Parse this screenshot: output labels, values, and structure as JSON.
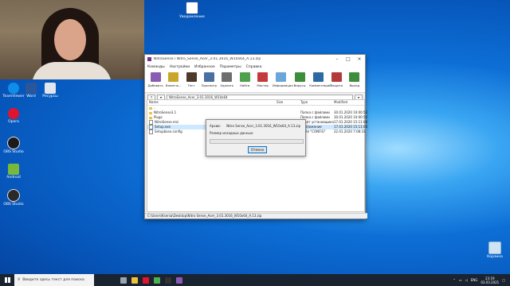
{
  "desktop": {
    "top_file_icon": "Уведомление",
    "icons_left": [
      {
        "label": "TeamViewer",
        "color": "#0e8ee9"
      },
      {
        "label": "Word",
        "color": "#2b579a"
      },
      {
        "label": "Ресурсы",
        "color": "#dfe6ee"
      },
      {
        "label": "Opera",
        "color": "#e0142e"
      },
      {
        "label": "OBS Studio",
        "color": "#1b1b1b"
      },
      {
        "label": "Android",
        "color": "#78b83a"
      },
      {
        "label": "OBS Studio",
        "color": "#2a2a2a"
      }
    ],
    "recycle_bin": "Корзина"
  },
  "window": {
    "title": "NitroSense / Nitro_Sense_Acer_3.01.3016_W10x64_A.13.zip",
    "menu": [
      "Команды",
      "Настройки",
      "Избранное",
      "Параметры",
      "Справка"
    ],
    "toolbar": [
      {
        "label": "Добавить",
        "color": "#8a5bb0"
      },
      {
        "label": "Извлечь...",
        "color": "#c9a52b"
      },
      {
        "label": "Тест",
        "color": "#4c3a2a"
      },
      {
        "label": "Просмотр",
        "color": "#4a6fa3"
      },
      {
        "label": "Удалить",
        "color": "#6e6e6e"
      },
      {
        "label": "Найти",
        "color": "#4ea04a"
      },
      {
        "label": "Мастер",
        "color": "#c43a3a"
      },
      {
        "label": "Информация",
        "color": "#6aa6d9"
      },
      {
        "label": "Вирусы",
        "color": "#3d8d3d"
      },
      {
        "label": "Комментарий",
        "color": "#2c6aa3"
      },
      {
        "label": "Защита",
        "color": "#b23a3a"
      },
      {
        "label": "Выход",
        "color": "#3d8d3d"
      }
    ],
    "address": "NitroSense_Acer_3.01.3016_W10x64",
    "columns": [
      "Name",
      "Size",
      "Type",
      "Modified"
    ],
    "files": [
      {
        "name": "..",
        "size": "",
        "type": "",
        "modified": "",
        "icon": "folder"
      },
      {
        "name": "NitroSense3.1",
        "size": "",
        "type": "Папка с файлами",
        "modified": "30.01.2020 10:00:50",
        "icon": "folder"
      },
      {
        "name": "Plugs",
        "size": "",
        "type": "Папка с файлами",
        "modified": "30.01.2020 10:00:50",
        "icon": "folder"
      },
      {
        "name": "NitroSense.msi",
        "size": "",
        "type": "Пакет установщика",
        "modified": "17.01.2020 15:11:08",
        "icon": "doc"
      },
      {
        "name": "Setup.exe",
        "size": "",
        "type": "Приложение",
        "modified": "17.01.2020 15:11:08",
        "icon": "doc"
      },
      {
        "name": "Setupbase.config",
        "size": "",
        "type": "Файл \"CONFIG\"",
        "modified": "22.01.2020 7:08:33",
        "icon": "doc"
      }
    ],
    "statusbar": "C:\\Users\\Ksenia\\Desktop\\Nitro Sense_Acer_3.01.3016_W10x64_A.13.zip"
  },
  "dialog": {
    "archive_label": "Архив:",
    "archive_value": "Nitro Sense_Acer_3.01.3016_W10x64_A.13.zip",
    "size_label": "Размер исходных данных:",
    "button": "Отмена"
  },
  "taskbar": {
    "search_placeholder": "Введите здесь текст для поиска",
    "apps": [
      {
        "name": "task-view",
        "color": "#9aa5b3"
      },
      {
        "name": "explorer",
        "color": "#f0c040"
      },
      {
        "name": "opera",
        "color": "#e0142e"
      },
      {
        "name": "chrome",
        "color": "#4caf50"
      },
      {
        "name": "obs",
        "color": "#333333"
      },
      {
        "name": "winrar",
        "color": "#8a5bb0"
      }
    ],
    "tray_lang": "ENG",
    "time": "23:19",
    "date": "03.03.2021"
  }
}
